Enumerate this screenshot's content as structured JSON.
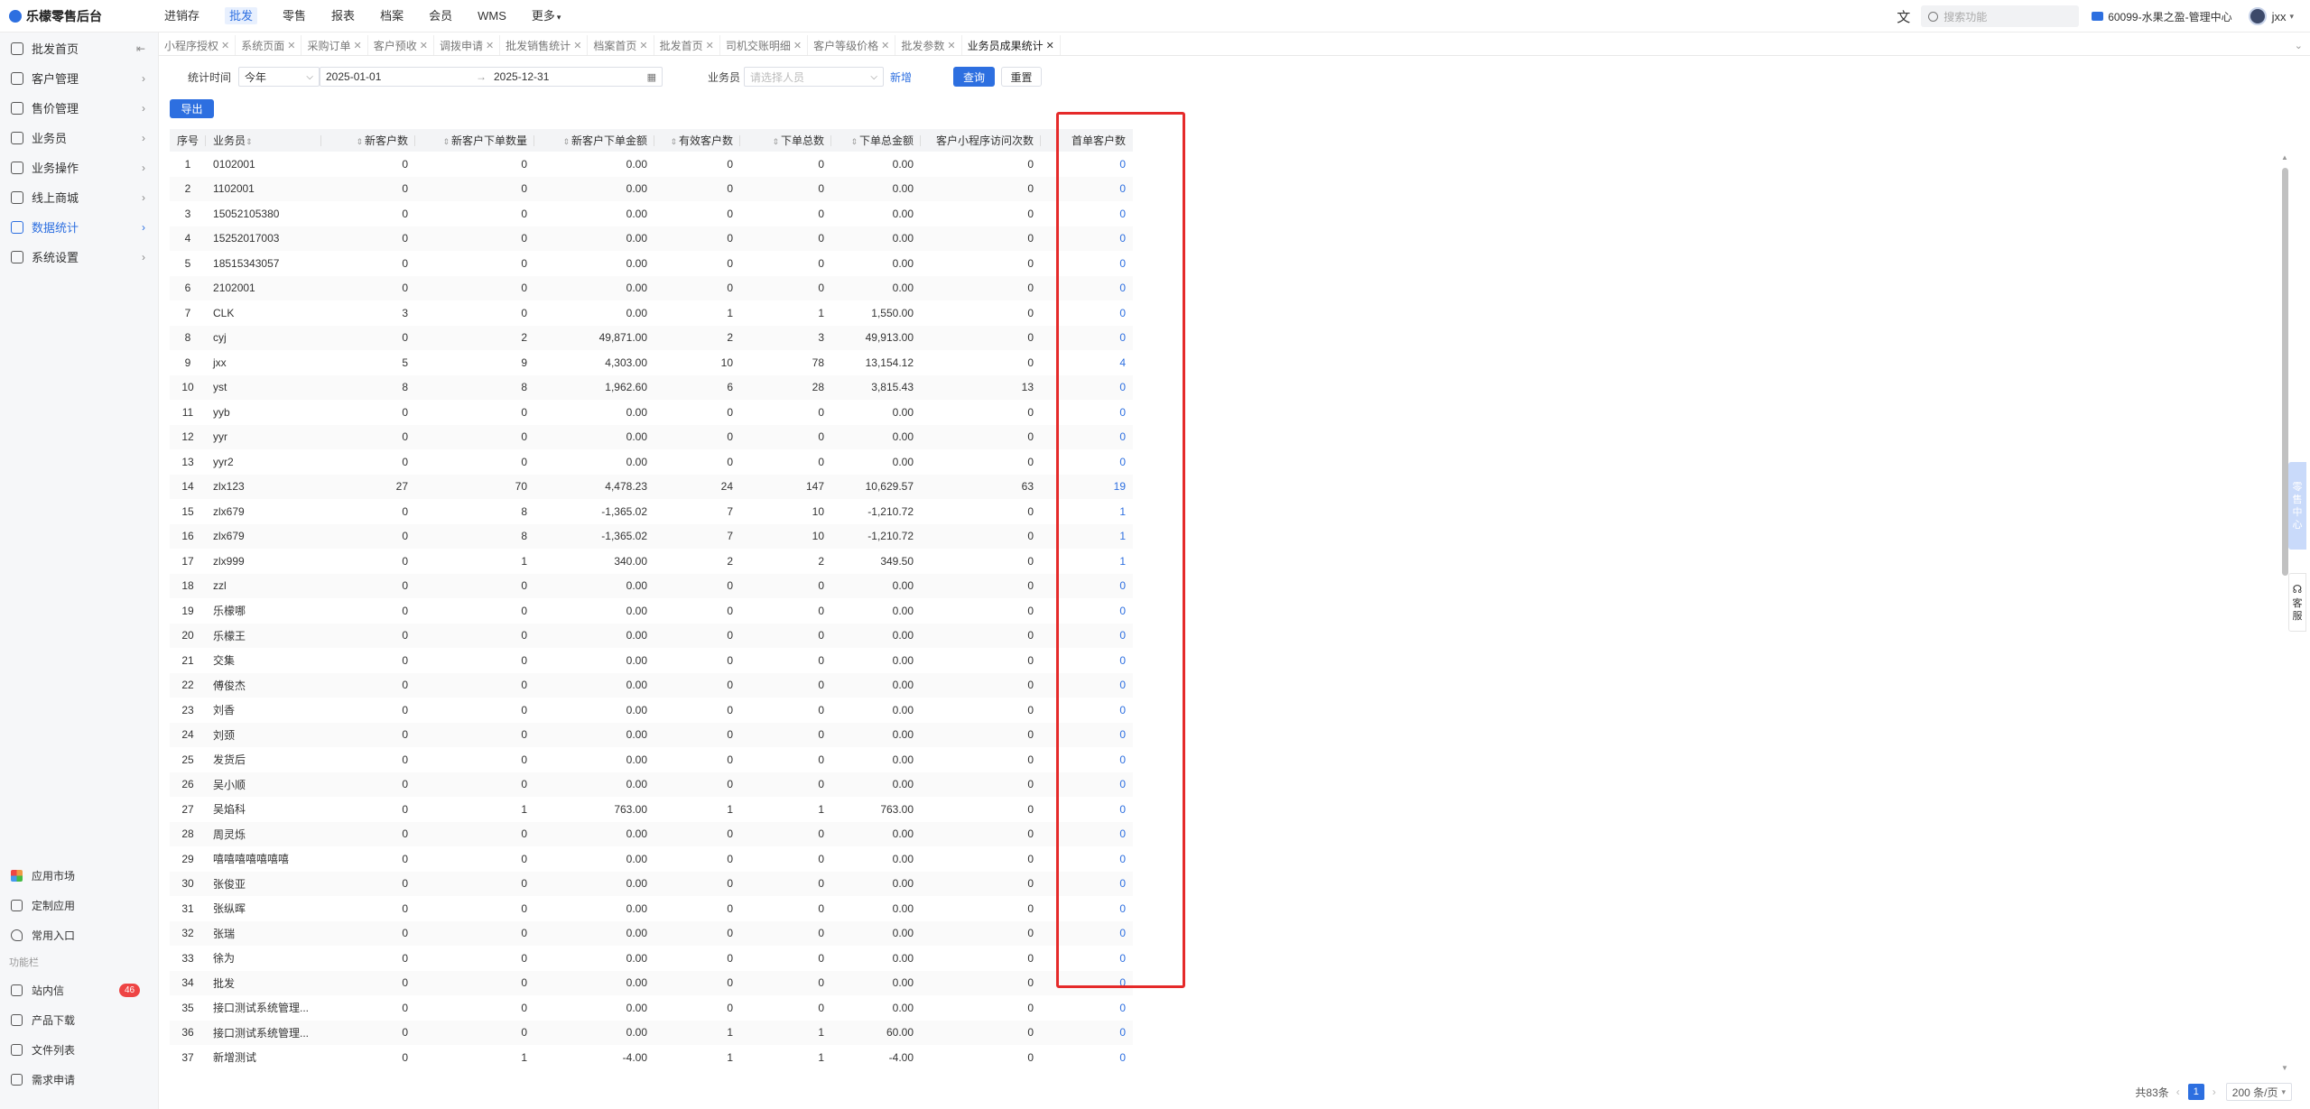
{
  "app": {
    "title": "乐檬零售后台"
  },
  "topnav": [
    {
      "label": "进销存",
      "active": false
    },
    {
      "label": "批发",
      "active": true
    },
    {
      "label": "零售",
      "active": false
    },
    {
      "label": "报表",
      "active": false
    },
    {
      "label": "档案",
      "active": false
    },
    {
      "label": "会员",
      "active": false
    },
    {
      "label": "WMS",
      "active": false
    },
    {
      "label": "更多",
      "active": false
    }
  ],
  "header": {
    "lang_icon": "文",
    "search_placeholder": "搜索功能",
    "store": "60099-水果之盈-管理中心",
    "user": "jxx"
  },
  "sidebar": {
    "items": [
      {
        "label": "批发首页",
        "arrow": "⇤",
        "active": false
      },
      {
        "label": "客户管理",
        "arrow": "›",
        "active": false
      },
      {
        "label": "售价管理",
        "arrow": "›",
        "active": false
      },
      {
        "label": "业务员",
        "arrow": "›",
        "active": false
      },
      {
        "label": "业务操作",
        "arrow": "›",
        "active": false
      },
      {
        "label": "线上商城",
        "arrow": "›",
        "active": false
      },
      {
        "label": "数据统计",
        "arrow": "›",
        "active": true
      },
      {
        "label": "系统设置",
        "arrow": "›",
        "active": false
      }
    ],
    "bottom": [
      {
        "label": "应用市场"
      },
      {
        "label": "定制应用"
      },
      {
        "label": "常用入口"
      }
    ],
    "section_label": "功能栏",
    "tools": [
      {
        "label": "站内信",
        "badge": "46"
      },
      {
        "label": "产品下载",
        "badge": ""
      },
      {
        "label": "文件列表",
        "badge": ""
      },
      {
        "label": "需求申请",
        "badge": ""
      }
    ]
  },
  "tabs": [
    {
      "label": "小程序授权",
      "active": false
    },
    {
      "label": "系统页面",
      "active": false
    },
    {
      "label": "采购订单",
      "active": false
    },
    {
      "label": "客户预收",
      "active": false
    },
    {
      "label": "调拨申请",
      "active": false
    },
    {
      "label": "批发销售统计",
      "active": false
    },
    {
      "label": "档案首页",
      "active": false
    },
    {
      "label": "批发首页",
      "active": false
    },
    {
      "label": "司机交账明细",
      "active": false
    },
    {
      "label": "客户等级价格",
      "active": false
    },
    {
      "label": "批发参数",
      "active": false
    },
    {
      "label": "业务员成果统计",
      "active": true
    }
  ],
  "filter": {
    "period_label": "统计时间",
    "period_value": "今年",
    "date_start": "2025-01-01",
    "date_sep": "→",
    "date_end": "2025-12-31",
    "salesman_label": "业务员",
    "salesman_placeholder": "请选择人员",
    "add_label": "新增",
    "query_label": "查询",
    "reset_label": "重置",
    "export_label": "导出"
  },
  "table": {
    "columns": [
      "序号",
      "业务员",
      "新客户数",
      "新客户下单数量",
      "新客户下单金额",
      "有效客户数",
      "下单总数",
      "下单总金额",
      "客户小程序访问次数",
      "首单客户数"
    ],
    "rows": [
      [
        "1",
        "0102001",
        "0",
        "0",
        "0.00",
        "0",
        "0",
        "0.00",
        "0",
        "0"
      ],
      [
        "2",
        "1102001",
        "0",
        "0",
        "0.00",
        "0",
        "0",
        "0.00",
        "0",
        "0"
      ],
      [
        "3",
        "15052105380",
        "0",
        "0",
        "0.00",
        "0",
        "0",
        "0.00",
        "0",
        "0"
      ],
      [
        "4",
        "15252017003",
        "0",
        "0",
        "0.00",
        "0",
        "0",
        "0.00",
        "0",
        "0"
      ],
      [
        "5",
        "18515343057",
        "0",
        "0",
        "0.00",
        "0",
        "0",
        "0.00",
        "0",
        "0"
      ],
      [
        "6",
        "2102001",
        "0",
        "0",
        "0.00",
        "0",
        "0",
        "0.00",
        "0",
        "0"
      ],
      [
        "7",
        "CLK",
        "3",
        "0",
        "0.00",
        "1",
        "1",
        "1,550.00",
        "0",
        "0"
      ],
      [
        "8",
        "cyj",
        "0",
        "2",
        "49,871.00",
        "2",
        "3",
        "49,913.00",
        "0",
        "0"
      ],
      [
        "9",
        "jxx",
        "5",
        "9",
        "4,303.00",
        "10",
        "78",
        "13,154.12",
        "0",
        "4"
      ],
      [
        "10",
        "yst",
        "8",
        "8",
        "1,962.60",
        "6",
        "28",
        "3,815.43",
        "13",
        "0"
      ],
      [
        "11",
        "yyb",
        "0",
        "0",
        "0.00",
        "0",
        "0",
        "0.00",
        "0",
        "0"
      ],
      [
        "12",
        "yyr",
        "0",
        "0",
        "0.00",
        "0",
        "0",
        "0.00",
        "0",
        "0"
      ],
      [
        "13",
        "yyr2",
        "0",
        "0",
        "0.00",
        "0",
        "0",
        "0.00",
        "0",
        "0"
      ],
      [
        "14",
        "zlx123",
        "27",
        "70",
        "4,478.23",
        "24",
        "147",
        "10,629.57",
        "63",
        "19"
      ],
      [
        "15",
        "zlx679",
        "0",
        "8",
        "-1,365.02",
        "7",
        "10",
        "-1,210.72",
        "0",
        "1"
      ],
      [
        "16",
        "zlx679",
        "0",
        "8",
        "-1,365.02",
        "7",
        "10",
        "-1,210.72",
        "0",
        "1"
      ],
      [
        "17",
        "zlx999",
        "0",
        "1",
        "340.00",
        "2",
        "2",
        "349.50",
        "0",
        "1"
      ],
      [
        "18",
        "zzl",
        "0",
        "0",
        "0.00",
        "0",
        "0",
        "0.00",
        "0",
        "0"
      ],
      [
        "19",
        "乐檬哪",
        "0",
        "0",
        "0.00",
        "0",
        "0",
        "0.00",
        "0",
        "0"
      ],
      [
        "20",
        "乐檬王",
        "0",
        "0",
        "0.00",
        "0",
        "0",
        "0.00",
        "0",
        "0"
      ],
      [
        "21",
        "交集",
        "0",
        "0",
        "0.00",
        "0",
        "0",
        "0.00",
        "0",
        "0"
      ],
      [
        "22",
        "傅俊杰",
        "0",
        "0",
        "0.00",
        "0",
        "0",
        "0.00",
        "0",
        "0"
      ],
      [
        "23",
        "刘香",
        "0",
        "0",
        "0.00",
        "0",
        "0",
        "0.00",
        "0",
        "0"
      ],
      [
        "24",
        "刘颈",
        "0",
        "0",
        "0.00",
        "0",
        "0",
        "0.00",
        "0",
        "0"
      ],
      [
        "25",
        "发货后",
        "0",
        "0",
        "0.00",
        "0",
        "0",
        "0.00",
        "0",
        "0"
      ],
      [
        "26",
        "吴小顺",
        "0",
        "0",
        "0.00",
        "0",
        "0",
        "0.00",
        "0",
        "0"
      ],
      [
        "27",
        "吴焰科",
        "0",
        "1",
        "763.00",
        "1",
        "1",
        "763.00",
        "0",
        "0"
      ],
      [
        "28",
        "周灵烁",
        "0",
        "0",
        "0.00",
        "0",
        "0",
        "0.00",
        "0",
        "0"
      ],
      [
        "29",
        "嘻嘻嘻嘻嘻嘻嘻",
        "0",
        "0",
        "0.00",
        "0",
        "0",
        "0.00",
        "0",
        "0"
      ],
      [
        "30",
        "张俊亚",
        "0",
        "0",
        "0.00",
        "0",
        "0",
        "0.00",
        "0",
        "0"
      ],
      [
        "31",
        "张纵晖",
        "0",
        "0",
        "0.00",
        "0",
        "0",
        "0.00",
        "0",
        "0"
      ],
      [
        "32",
        "张瑞",
        "0",
        "0",
        "0.00",
        "0",
        "0",
        "0.00",
        "0",
        "0"
      ],
      [
        "33",
        "徐为",
        "0",
        "0",
        "0.00",
        "0",
        "0",
        "0.00",
        "0",
        "0"
      ],
      [
        "34",
        "批发",
        "0",
        "0",
        "0.00",
        "0",
        "0",
        "0.00",
        "0",
        "0"
      ],
      [
        "35",
        "接口测试系统管理...",
        "0",
        "0",
        "0.00",
        "0",
        "0",
        "0.00",
        "0",
        "0"
      ],
      [
        "36",
        "接口测试系统管理...",
        "0",
        "0",
        "0.00",
        "1",
        "1",
        "60.00",
        "0",
        "0"
      ],
      [
        "37",
        "新增测试",
        "0",
        "1",
        "-4.00",
        "1",
        "1",
        "-4.00",
        "0",
        "0"
      ]
    ]
  },
  "float": {
    "customer_center": "零售中心",
    "service": "客服"
  },
  "pagination": {
    "total": "共83条",
    "current": "1",
    "page_size": "200 条/页",
    "prev": "‹",
    "next": "›"
  }
}
